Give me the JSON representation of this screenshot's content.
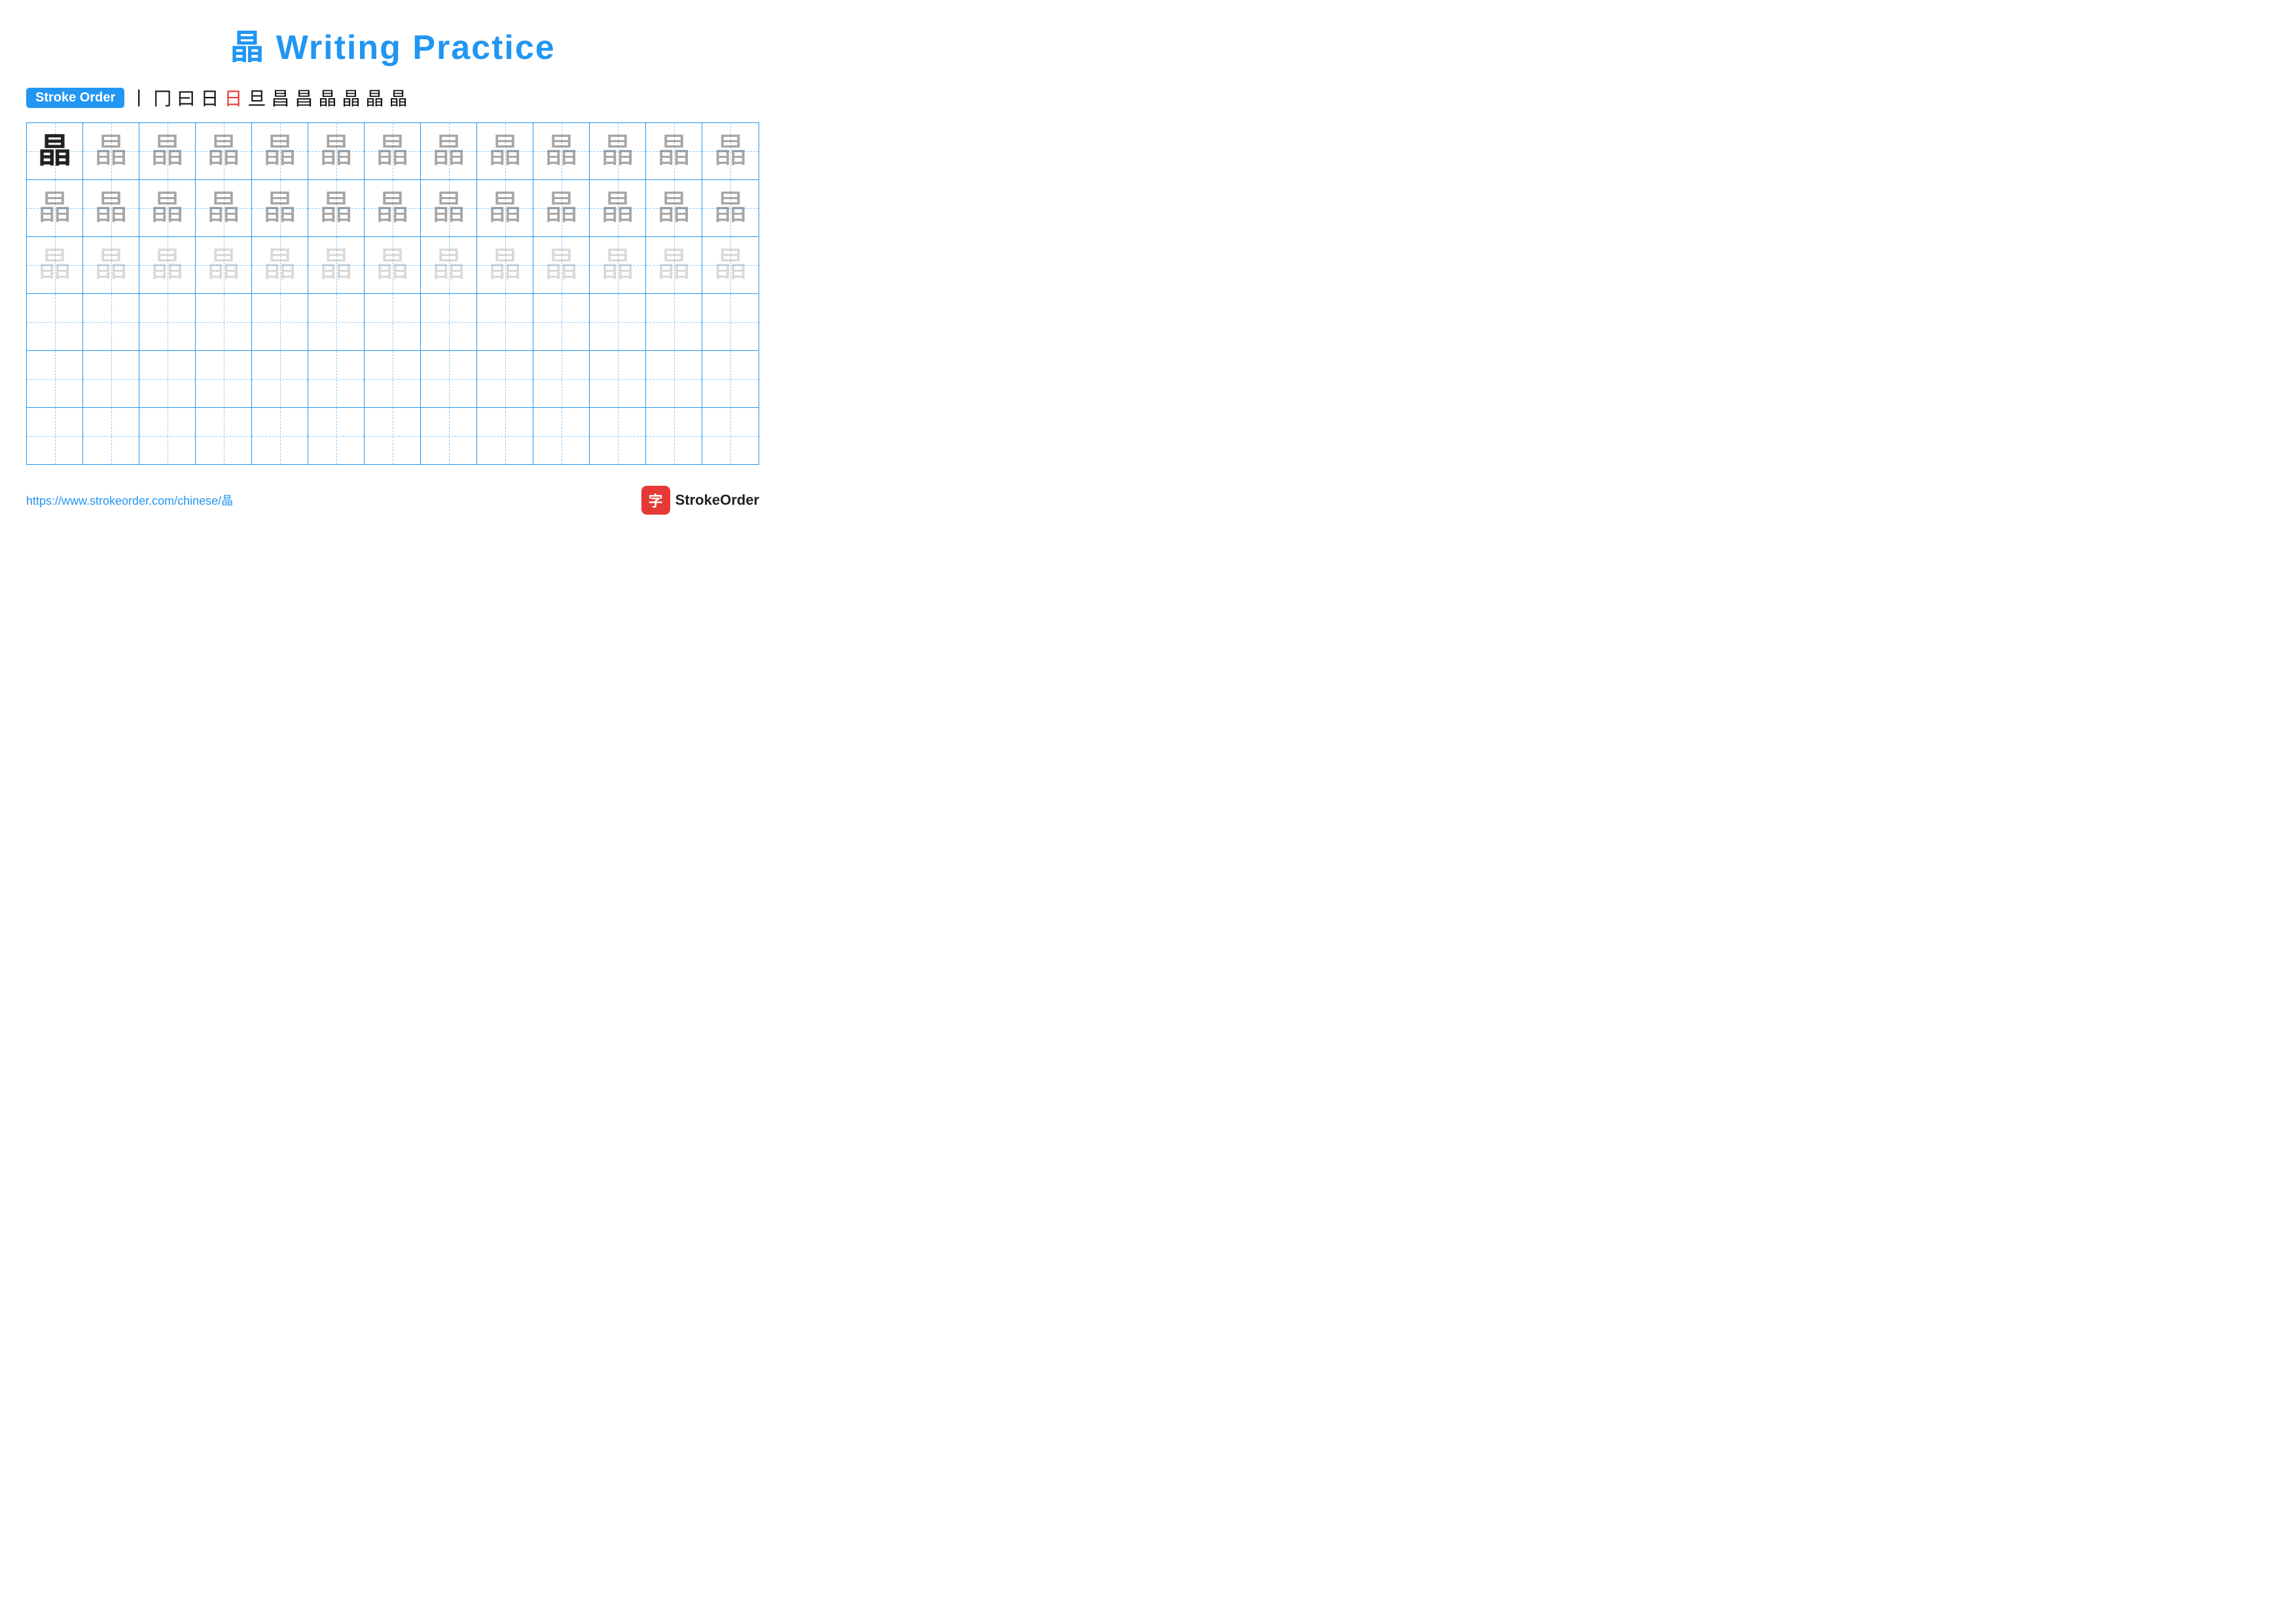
{
  "title": {
    "char": "晶",
    "text": "Writing Practice",
    "full": "晶 Writing Practice"
  },
  "stroke_order": {
    "badge_label": "Stroke Order",
    "strokes": [
      {
        "char": "丨",
        "red": false
      },
      {
        "char": "冂",
        "red": false
      },
      {
        "char": "曰",
        "red": false
      },
      {
        "char": "日",
        "red": false
      },
      {
        "char": "日",
        "red": true
      },
      {
        "char": "旦",
        "red": false
      },
      {
        "char": "昌",
        "red": false
      },
      {
        "char": "昌",
        "red": false
      },
      {
        "char": "晶",
        "red": false
      },
      {
        "char": "晶",
        "red": false
      },
      {
        "char": "晶",
        "red": false
      },
      {
        "char": "晶",
        "red": false
      }
    ]
  },
  "grid": {
    "rows": 6,
    "cols": 13,
    "char": "晶",
    "row_configs": [
      {
        "type": "dark_then_medium",
        "dark_count": 1,
        "medium_count": 12
      },
      {
        "type": "all_medium"
      },
      {
        "type": "all_light"
      },
      {
        "type": "empty"
      },
      {
        "type": "empty"
      },
      {
        "type": "empty"
      }
    ]
  },
  "footer": {
    "url": "https://www.strokeorder.com/chinese/晶",
    "logo_icon": "字",
    "logo_text": "StrokeOrder"
  }
}
